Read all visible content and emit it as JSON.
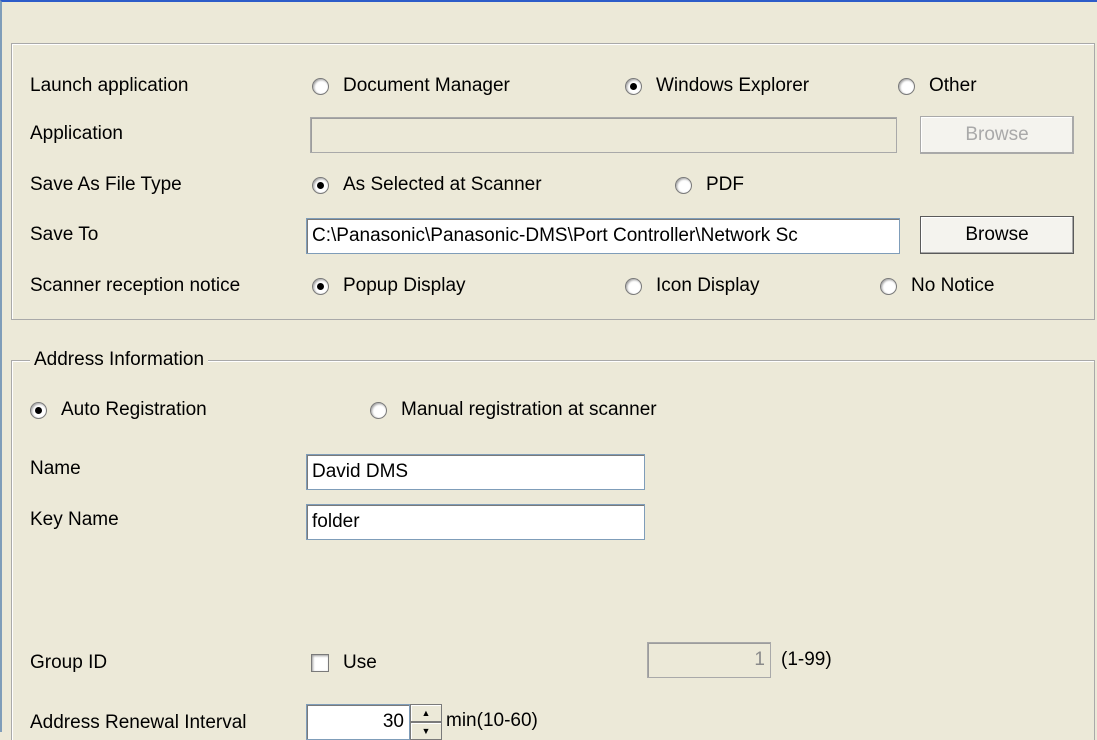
{
  "settings": {
    "launch_application": {
      "label": "Launch application",
      "options": [
        "Document Manager",
        "Windows Explorer",
        "Other"
      ],
      "selected": "Windows Explorer"
    },
    "application": {
      "label": "Application",
      "value": "",
      "browse_label": "Browse",
      "browse_enabled": false
    },
    "save_as_file_type": {
      "label": "Save As File Type",
      "options": [
        "As Selected at Scanner",
        "PDF"
      ],
      "selected": "As Selected at Scanner"
    },
    "save_to": {
      "label": "Save To",
      "value": "C:\\Panasonic\\Panasonic-DMS\\Port Controller\\Network Sc",
      "browse_label": "Browse",
      "browse_enabled": true
    },
    "scanner_reception_notice": {
      "label": "Scanner reception notice",
      "options": [
        "Popup Display",
        "Icon Display",
        "No Notice"
      ],
      "selected": "Popup Display"
    }
  },
  "address_information": {
    "title": "Address Information",
    "registration": {
      "options": [
        "Auto Registration",
        "Manual registration at scanner"
      ],
      "selected": "Auto Registration"
    },
    "name": {
      "label": "Name",
      "value": "David DMS"
    },
    "key_name": {
      "label": "Key Name",
      "value": "folder"
    },
    "group_id": {
      "label": "Group ID",
      "use_label": "Use",
      "use_checked": false,
      "value": "1",
      "range": "(1-99)"
    },
    "renewal_interval": {
      "label": "Address Renewal Interval",
      "value": "30",
      "unit_range": "min(10-60)"
    }
  },
  "colors": {
    "window_background": "#ece9d8",
    "border_blue": "#2d5cc9",
    "disabled_text": "#a9a9a9"
  }
}
